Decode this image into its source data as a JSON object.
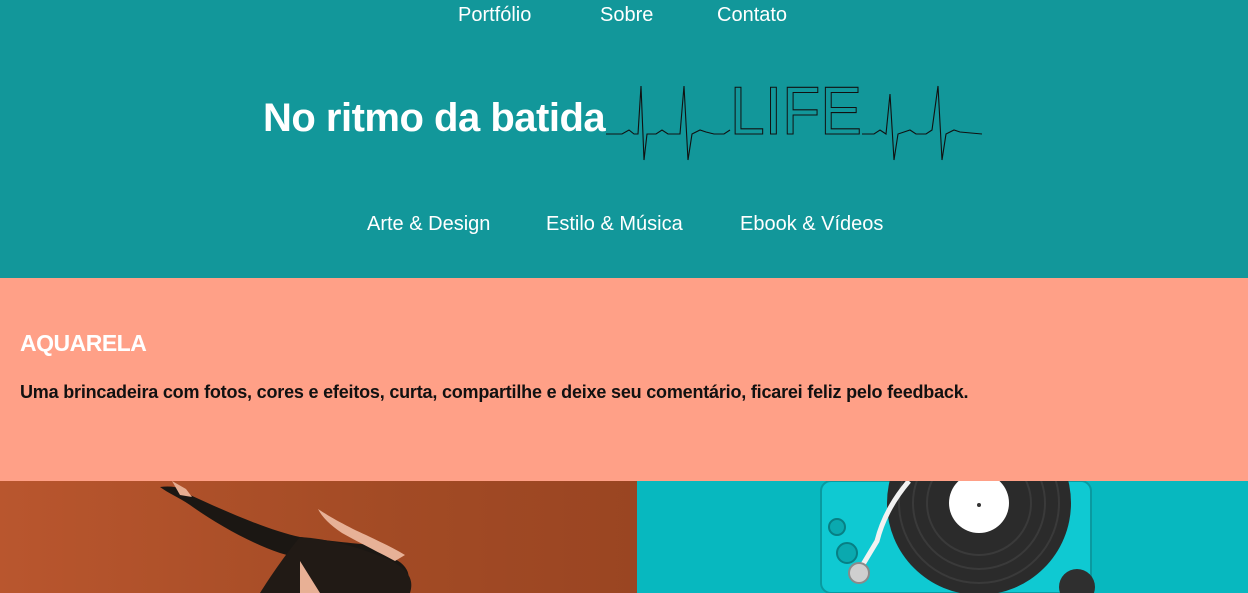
{
  "top_nav": {
    "portfolio": "Portfólio",
    "about": "Sobre",
    "contact": "Contato"
  },
  "brand": {
    "title": "No ritmo da batida",
    "logo_text": "LIFE"
  },
  "category_nav": {
    "art": "Arte & Design",
    "style": "Estilo & Música",
    "ebook": "Ebook & Vídeos"
  },
  "intro": {
    "heading": "AQUARELA",
    "body": "Uma brincadeira com fotos, cores e efeitos, curta, compartilhe e deixe seu comentário, ficarei feliz pelo feedback."
  },
  "gallery": {
    "items": [
      "dancer-photo",
      "turntable-photo"
    ]
  },
  "colors": {
    "header_bg": "#12979a",
    "intro_bg": "#ffa087",
    "record_bg": "#07b8bf",
    "dancer_bg": "#a34b25"
  }
}
